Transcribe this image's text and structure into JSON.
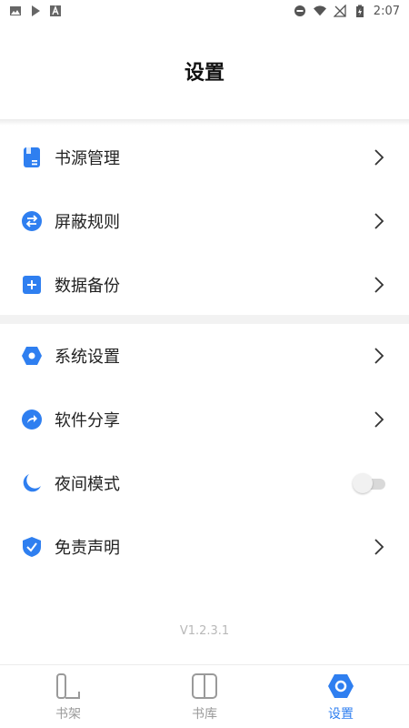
{
  "status_bar": {
    "time": "2:07"
  },
  "header": {
    "title": "设置"
  },
  "colors": {
    "accent": "#2f7ff0",
    "muted": "#9a9a9a"
  },
  "list_group_1": [
    {
      "label": "书源管理",
      "icon": "book-source-icon"
    },
    {
      "label": "屏蔽规则",
      "icon": "swap-icon"
    },
    {
      "label": "数据备份",
      "icon": "plus-box-icon"
    }
  ],
  "list_group_2": [
    {
      "label": "系统设置",
      "icon": "hexagon-gear-icon"
    },
    {
      "label": "软件分享",
      "icon": "share-icon"
    },
    {
      "label": "夜间模式",
      "icon": "moon-icon",
      "toggle": false
    },
    {
      "label": "免责声明",
      "icon": "shield-check-icon"
    }
  ],
  "version": "V1.2.3.1",
  "tabbar": {
    "tabs": [
      {
        "label": "书架",
        "icon": "bookshelf-icon",
        "active": false
      },
      {
        "label": "书库",
        "icon": "library-icon",
        "active": false
      },
      {
        "label": "设置",
        "icon": "settings-icon",
        "active": true
      }
    ]
  }
}
